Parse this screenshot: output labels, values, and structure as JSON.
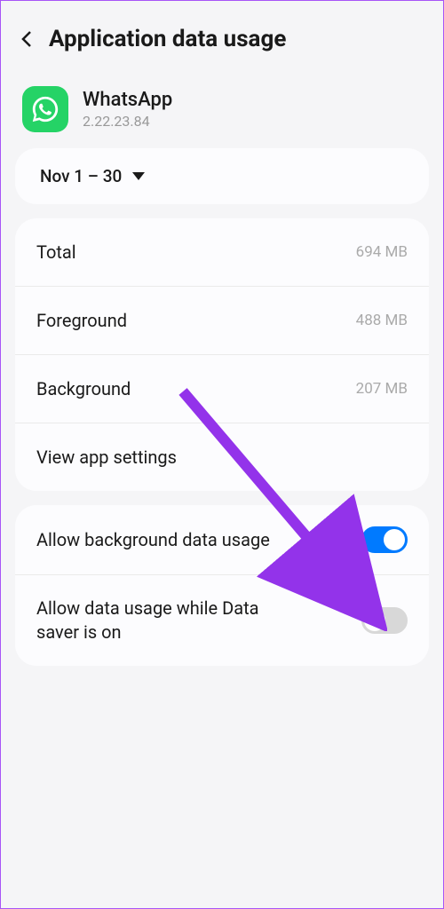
{
  "header": {
    "title": "Application data usage"
  },
  "app": {
    "name": "WhatsApp",
    "version": "2.22.23.84"
  },
  "dateRange": {
    "label": "Nov 1 – 30"
  },
  "stats": {
    "total": {
      "label": "Total",
      "value": "694 MB"
    },
    "foreground": {
      "label": "Foreground",
      "value": "488 MB"
    },
    "background": {
      "label": "Background",
      "value": "207 MB"
    }
  },
  "links": {
    "viewAppSettings": "View app settings"
  },
  "toggles": {
    "allowBackground": {
      "label": "Allow background data usage",
      "on": true
    },
    "allowDataSaver": {
      "label": "Allow data usage while Data saver is on",
      "on": false
    }
  }
}
